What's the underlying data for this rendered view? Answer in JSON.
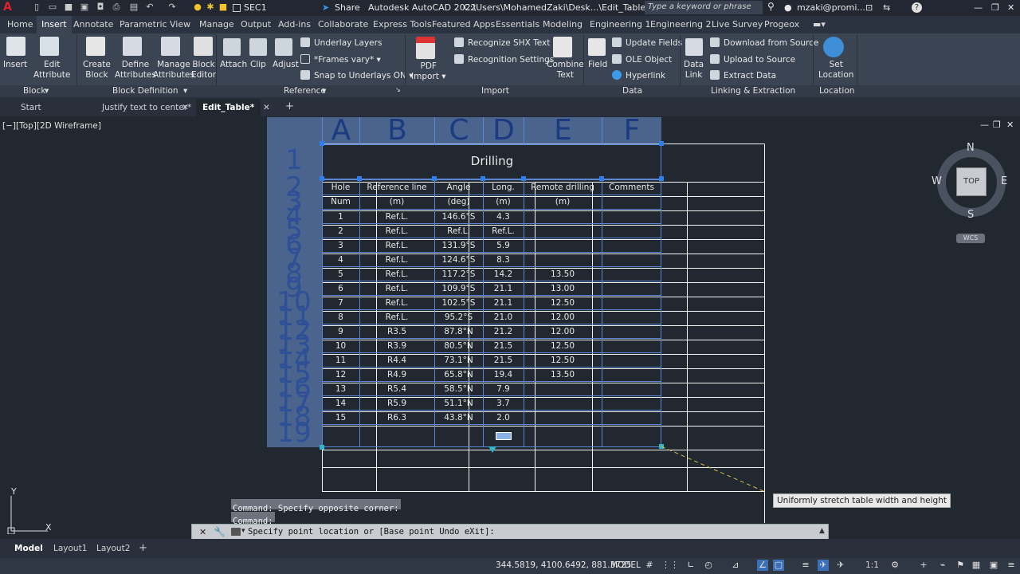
{
  "titlebar": {
    "app_letter": "A",
    "workspace": "SEC1",
    "share": "Share",
    "app_title": "Autodesk AutoCAD 2022",
    "file_path": "C:\\Users\\MohamedZaki\\Desk...\\Edit_Table.dwg",
    "search_placeholder": "Type a keyword or phrase",
    "user": "mzaki@promi..."
  },
  "ribbon_tabs": [
    "Home",
    "Insert",
    "Annotate",
    "Parametric",
    "View",
    "Manage",
    "Output",
    "Add-ins",
    "Collaborate",
    "Express Tools",
    "Featured Apps",
    "Essentials",
    "Modeling",
    "Engineering 1",
    "Engineering 2",
    "Live Survey",
    "Progeox"
  ],
  "ribbon": {
    "insert": "Insert",
    "edit_attribute": [
      "Edit",
      "Attribute"
    ],
    "create_block": [
      "Create",
      "Block"
    ],
    "define_attributes": [
      "Define",
      "Attributes"
    ],
    "manage_attributes": [
      "Manage",
      "Attributes"
    ],
    "block_editor": [
      "Block",
      "Editor"
    ],
    "attach": "Attach",
    "clip": "Clip",
    "adjust": "Adjust",
    "underlay_layers": "Underlay Layers",
    "frames_vary": "*Frames vary*",
    "snap_underlays": "Snap to Underlays ON",
    "pdf_import": [
      "PDF",
      "Import"
    ],
    "recognize_shx": "Recognize SHX Text",
    "recognition_settings": "Recognition Settings",
    "combine_text": [
      "Combine",
      "Text"
    ],
    "field": "Field",
    "update_fields": "Update Fields",
    "ole_object": "OLE Object",
    "hyperlink": "Hyperlink",
    "data_link": [
      "Data",
      "Link"
    ],
    "download_source": "Download from Source",
    "upload_source": "Upload to Source",
    "extract_data": "Extract  Data",
    "set_location": [
      "Set",
      "Location"
    ]
  },
  "panels": [
    "Block",
    "Block Definition",
    "Reference",
    "Import",
    "Data",
    "Linking & Extraction",
    "Location"
  ],
  "file_tabs": [
    "Start",
    "Justify text to center*",
    "Edit_Table*"
  ],
  "viewport_label": "[−][Top][2D Wireframe]",
  "viewcube": {
    "n": "N",
    "s": "S",
    "e": "E",
    "w": "W",
    "top": "TOP",
    "wcs": "WCS"
  },
  "table": {
    "column_letters": [
      "A",
      "B",
      "C",
      "D",
      "E",
      "F"
    ],
    "row_numbers": [
      "1",
      "2",
      "3",
      "4",
      "5",
      "6",
      "7",
      "8",
      "9",
      "10",
      "11",
      "12",
      "13",
      "14",
      "15",
      "16",
      "17",
      "18",
      "19"
    ],
    "title": "Drilling",
    "headers1": [
      "Hole",
      "Reference  line",
      "Angle",
      "Long.",
      "Remote  drilling",
      "Comments"
    ],
    "headers2": [
      "Num",
      "(m)",
      "(deg)",
      "(m)",
      "(m)",
      ""
    ],
    "rows": [
      [
        "1",
        "Ref.L.",
        "146.6°S",
        "4.3",
        ""
      ],
      [
        "2",
        "Ref.L.",
        "Ref.L.",
        "Ref.L.",
        ""
      ],
      [
        "3",
        "Ref.L.",
        "131.9°S",
        "5.9",
        ""
      ],
      [
        "4",
        "Ref.L.",
        "124.6°S",
        "8.3",
        ""
      ],
      [
        "5",
        "Ref.L.",
        "117.2°S",
        "14.2",
        "13.50"
      ],
      [
        "6",
        "Ref.L.",
        "109.9°S",
        "21.1",
        "13.00"
      ],
      [
        "7",
        "Ref.L.",
        "102.5°S",
        "21.1",
        "12.50"
      ],
      [
        "8",
        "Ref.L.",
        "95.2°S",
        "21.0",
        "12.00"
      ],
      [
        "9",
        "R3.5",
        "87.8°N",
        "21.2",
        "12.00"
      ],
      [
        "10",
        "R3.9",
        "80.5°N",
        "21.5",
        "12.50"
      ],
      [
        "11",
        "R4.4",
        "73.1°N",
        "21.5",
        "12.50"
      ],
      [
        "12",
        "R4.9",
        "65.8°N",
        "19.4",
        "13.50"
      ],
      [
        "13",
        "R5.4",
        "58.5°N",
        "7.9",
        ""
      ],
      [
        "14",
        "R5.9",
        "51.1°N",
        "3.7",
        ""
      ],
      [
        "15",
        "R6.3",
        "43.8°N",
        "2.0",
        ""
      ]
    ]
  },
  "tooltip": "Uniformly stretch table width and height",
  "command": {
    "line1": "Command: Specify opposite corner:",
    "line2": "Command:",
    "prompt": "Specify point location or [Base point Undo eXit]:"
  },
  "layout_tabs": [
    "Model",
    "Layout1",
    "Layout2"
  ],
  "status": {
    "coords": "344.5819, 4100.6492, 881.3725",
    "space": "MODEL",
    "scale": "1:1"
  }
}
